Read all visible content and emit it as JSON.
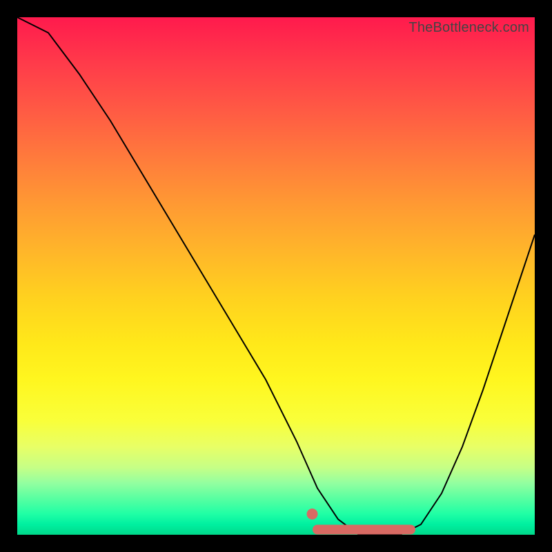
{
  "watermark": "TheBottleneck.com",
  "chart_data": {
    "type": "line",
    "title": "",
    "xlabel": "",
    "ylabel": "",
    "xlim": [
      0,
      100
    ],
    "ylim": [
      0,
      100
    ],
    "grid": false,
    "series": [
      {
        "name": "bottleneck-curve",
        "x": [
          0,
          6,
          12,
          18,
          24,
          30,
          36,
          42,
          48,
          54,
          58,
          62,
          66,
          70,
          74,
          78,
          82,
          86,
          90,
          94,
          98,
          100
        ],
        "values": [
          100,
          97,
          89,
          80,
          70,
          60,
          50,
          40,
          30,
          18,
          9,
          3,
          0,
          0,
          0,
          2,
          8,
          17,
          28,
          40,
          52,
          58
        ]
      }
    ],
    "annotations": [
      {
        "name": "optimal-range-band",
        "x_start": 58,
        "x_end": 76,
        "y": 1
      },
      {
        "name": "optimal-range-marker",
        "x": 57,
        "y": 4
      }
    ],
    "background_gradient": {
      "top": "#ff1a4d",
      "mid": "#ffe81a",
      "bottom": "#00d98a"
    }
  }
}
